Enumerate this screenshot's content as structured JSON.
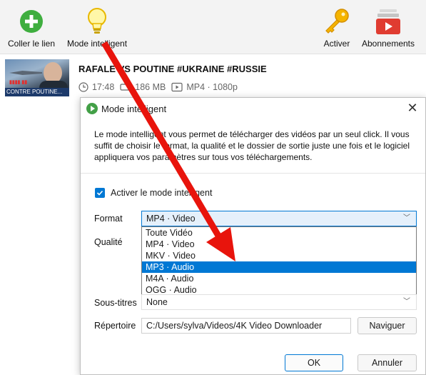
{
  "toolbar": {
    "paste_label": "Coller le lien",
    "smart_label": "Mode intelligent",
    "activate_label": "Activer",
    "subscriptions_label": "Abonnements"
  },
  "download": {
    "title": "RAFALE VS POUTINE  #UKRAINE #RUSSIE",
    "thumbnail_caption": "CONTRE POUTINE...",
    "duration": "17:48",
    "size": "186 MB",
    "format": "MP4 · 1080p"
  },
  "dialog": {
    "title": "Mode intelligent",
    "close_glyph": "✕",
    "description": "Le mode intelligent vous permet de télécharger des vidéos par un seul click. Il vous suffit de choisir le format, la qualité et le dossier de sortie juste une fois et le logiciel appliquera vos paramètres sur tous vos téléchargements.",
    "checkbox_label": "Activer le mode intelligent",
    "checkbox_checked": true,
    "format_label": "Format",
    "format_value": "MP4 · Video",
    "quality_label": "Qualité",
    "format_options": [
      "Toute Vidéo",
      "MP4 · Video",
      "MKV · Video",
      "MP3 · Audio",
      "M4A · Audio",
      "OGG · Audio"
    ],
    "highlighted_option": "MP3 · Audio",
    "subtitles_label": "Sous-titres",
    "subtitles_value": "None",
    "directory_label": "Répertoire",
    "directory_value": "C:/Users/sylva/Videos/4K Video Downloader",
    "browse_label": "Naviguer",
    "ok_label": "OK",
    "cancel_label": "Annuler"
  },
  "colors": {
    "accent": "#0078d4",
    "annotation_arrow": "#e8140c",
    "paste_icon": "#3fae3f",
    "subscriptions_icon": "#e03c31"
  }
}
